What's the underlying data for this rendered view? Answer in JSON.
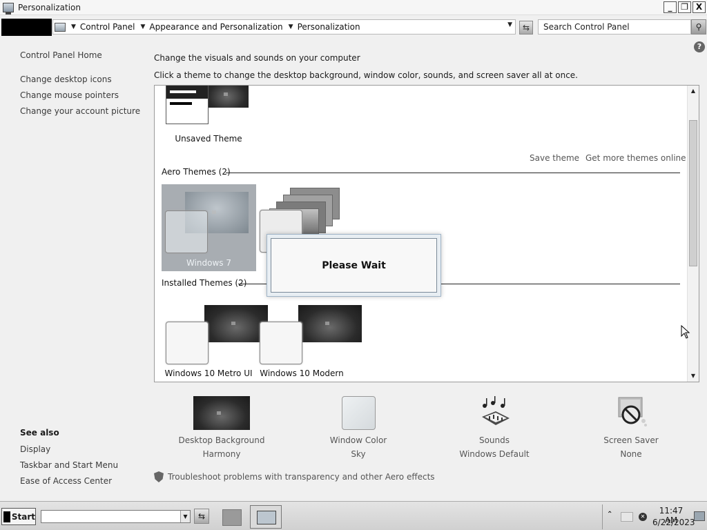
{
  "window": {
    "title": "Personalization"
  },
  "window_controls": {
    "minimize": "_",
    "restore": "❐",
    "close": "X"
  },
  "address": {
    "crumbs": [
      "Control Panel",
      "Appearance and Personalization",
      "Personalization"
    ],
    "search_placeholder": "Search Control Panel"
  },
  "help": {
    "label": "?"
  },
  "sidebar": {
    "home": "Control Panel Home",
    "links": [
      "Change desktop icons",
      "Change mouse pointers",
      "Change your account picture"
    ],
    "see_also_title": "See also",
    "see_also": [
      "Display",
      "Taskbar and Start Menu",
      "Ease of Access Center"
    ]
  },
  "main": {
    "heading": "Change the visuals and sounds on your computer",
    "subheading": "Click a theme to change the desktop background, window color, sounds, and screen saver all at once."
  },
  "themes": {
    "my_themes": [
      {
        "label": "Unsaved Theme"
      }
    ],
    "actions": {
      "save": "Save theme",
      "get_more": "Get more themes online"
    },
    "aero_section": "Aero Themes (2)",
    "aero": [
      {
        "label": "Windows 7",
        "selected": true
      }
    ],
    "installed_section": "Installed Themes (2)",
    "installed": [
      {
        "label": "Windows 10 Metro UI"
      },
      {
        "label": "Windows 10 Modern"
      }
    ]
  },
  "dialog": {
    "message": "Please Wait"
  },
  "settings": [
    {
      "label": "Desktop Background",
      "value": "Harmony",
      "icon": "desktop-background-icon"
    },
    {
      "label": "Window Color",
      "value": "Sky",
      "icon": "window-color-icon"
    },
    {
      "label": "Sounds",
      "value": "Windows Default",
      "icon": "sounds-icon"
    },
    {
      "label": "Screen Saver",
      "value": "None",
      "icon": "screen-saver-icon"
    }
  ],
  "troubleshoot": {
    "text": "Troubleshoot problems with transparency and other Aero effects"
  },
  "taskbar": {
    "start_label": "Start",
    "time": "11:47 AM",
    "date": "6/22/2023"
  }
}
